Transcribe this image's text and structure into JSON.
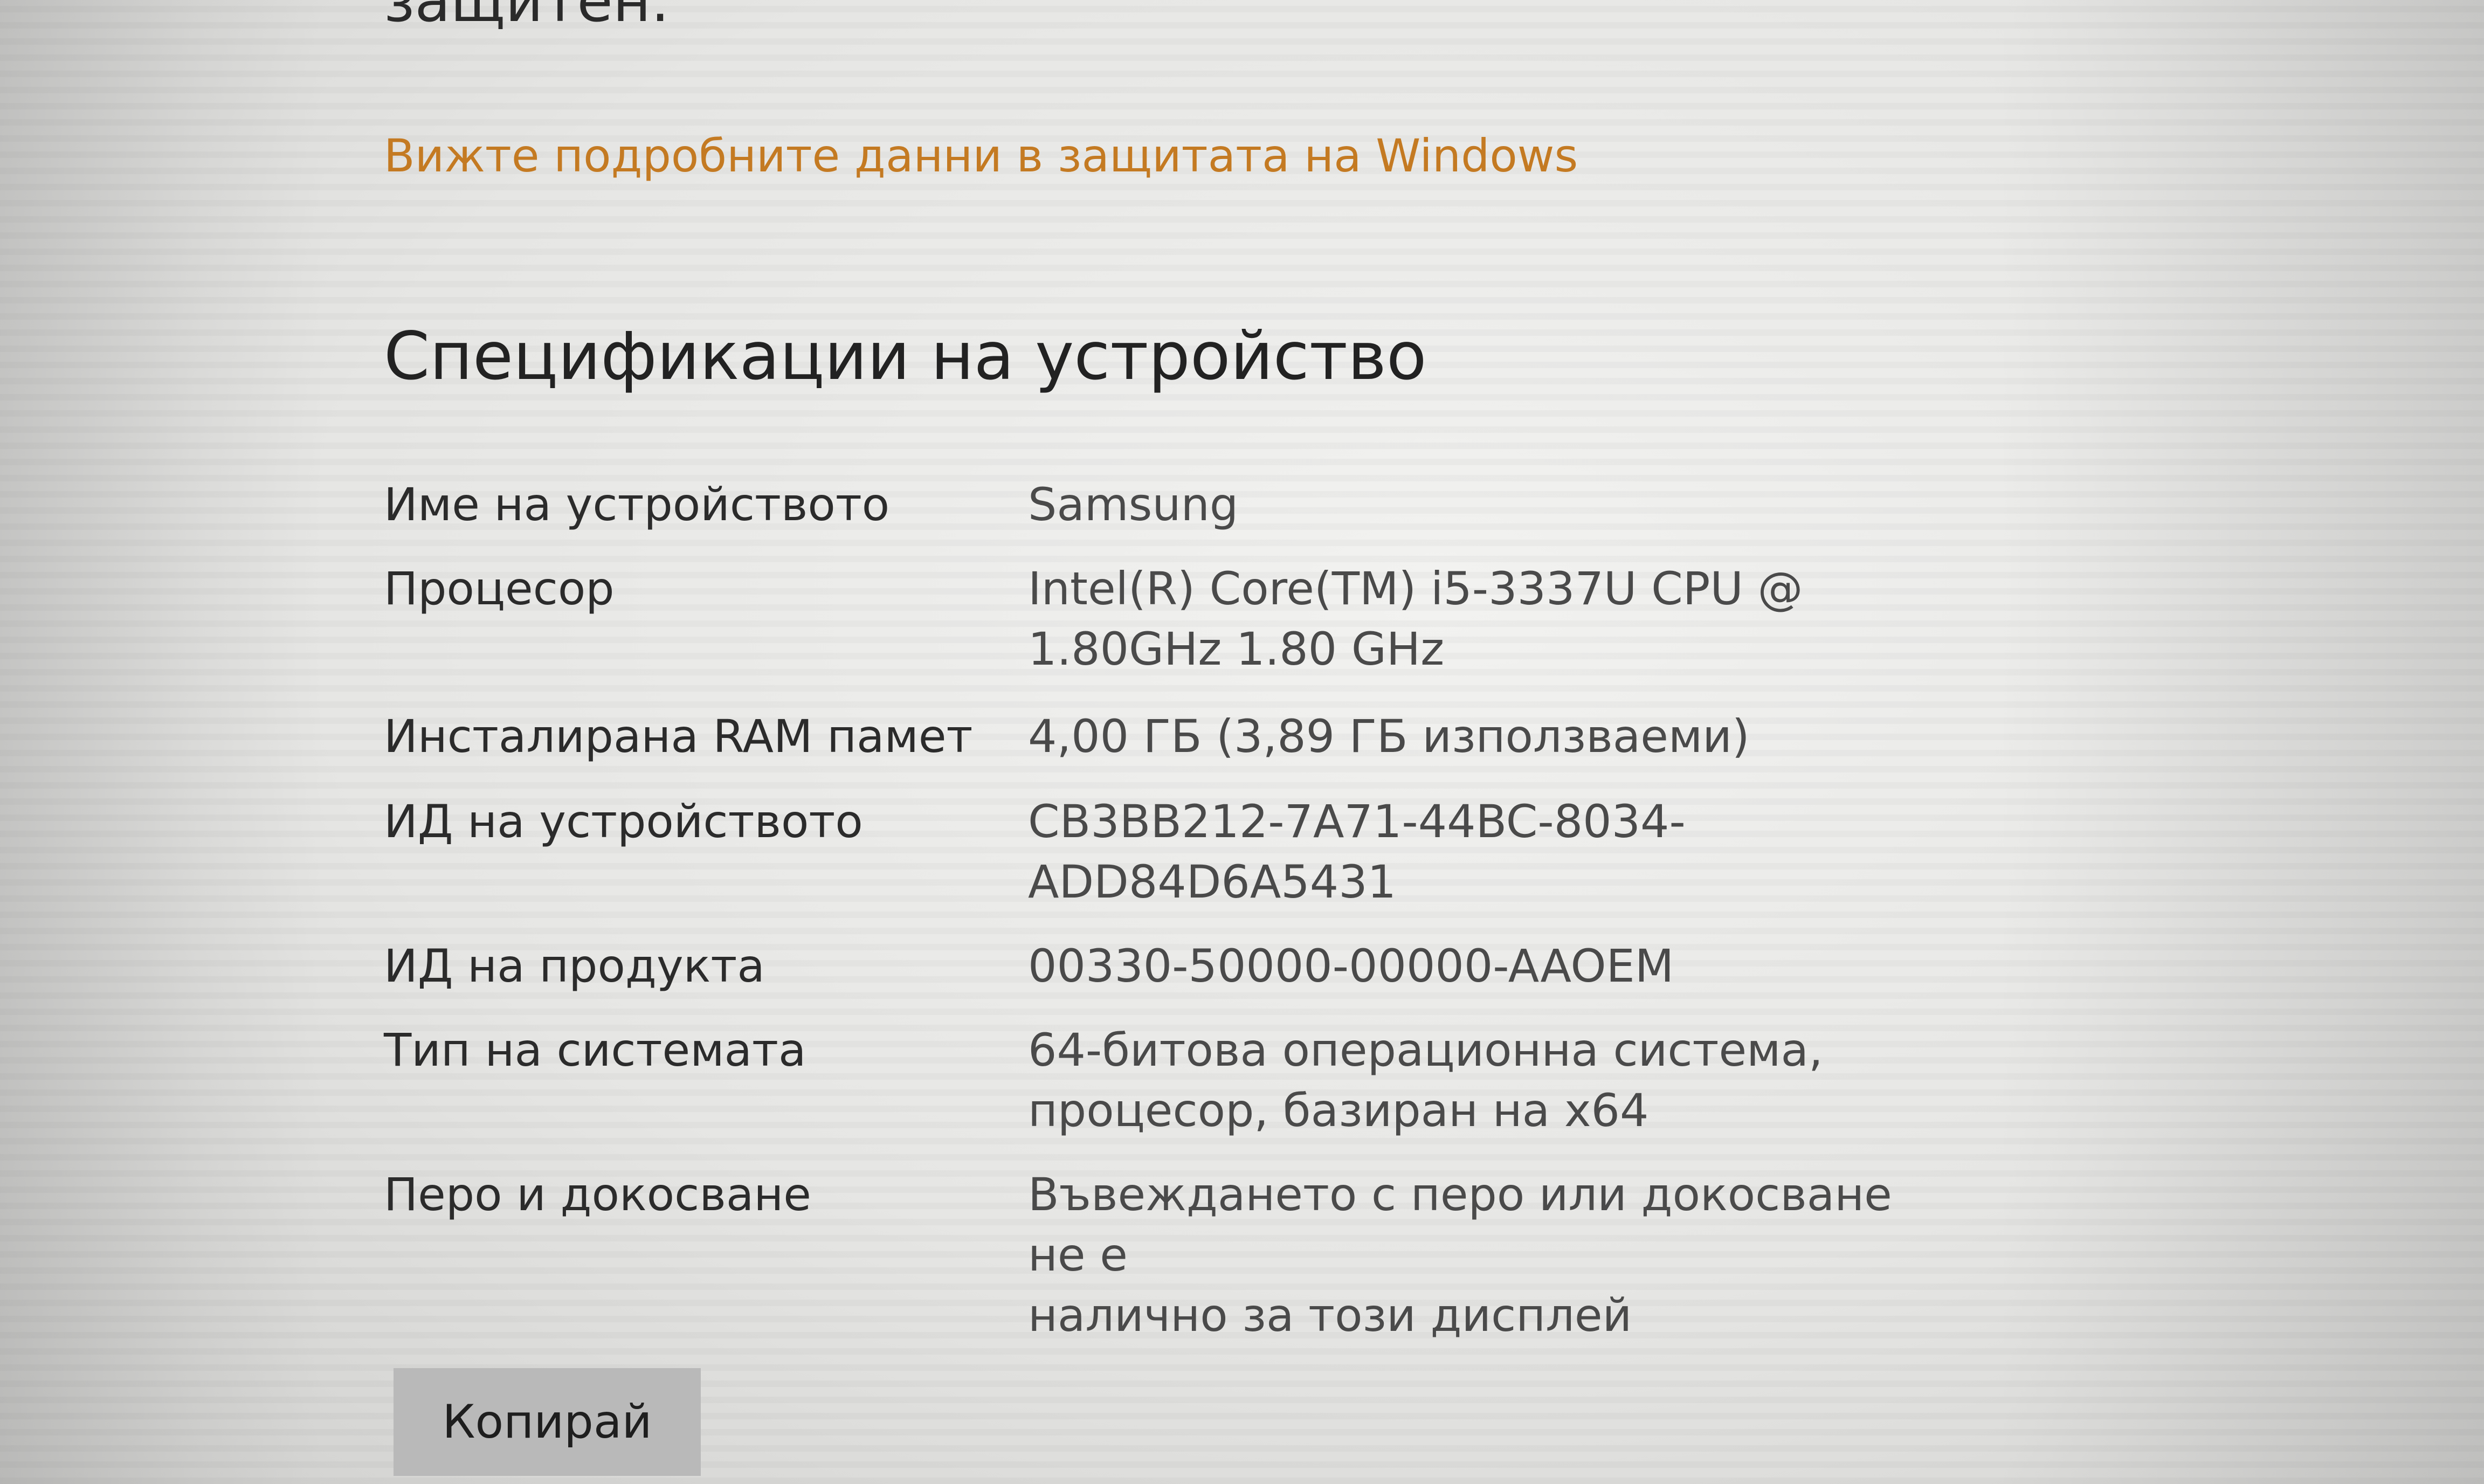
{
  "header": {
    "status_fragment": "защитен."
  },
  "security": {
    "link_text": "Вижте подробните данни в защитата на Windows"
  },
  "specs": {
    "title": "Спецификации на устройство",
    "rows": [
      {
        "label": "Име на устройството",
        "value": "Samsung"
      },
      {
        "label": "Процесор",
        "value": "Intel(R) Core(TM) i5-3337U CPU @\n1.80GHz   1.80 GHz"
      },
      {
        "label": "Инсталирана RAM памет",
        "value": "4,00 ГБ (3,89 ГБ използваеми)"
      },
      {
        "label": "ИД на устройството",
        "value": "CB3BB212-7A71-44BC-8034-\nADD84D6A5431"
      },
      {
        "label": "ИД на продукта",
        "value": "00330-50000-00000-AAOEM"
      },
      {
        "label": "Тип на системата",
        "value": "64-битова операционна система,\nпроцесор, базиран на x64"
      },
      {
        "label": "Перо и докосване",
        "value": "Въвеждането с перо или докосване не е\nналично за този дисплей"
      }
    ],
    "copy_button": "Копирай"
  },
  "colors": {
    "link": "#c47a22",
    "text": "#262626",
    "button_bg": "#b9b9b9"
  }
}
